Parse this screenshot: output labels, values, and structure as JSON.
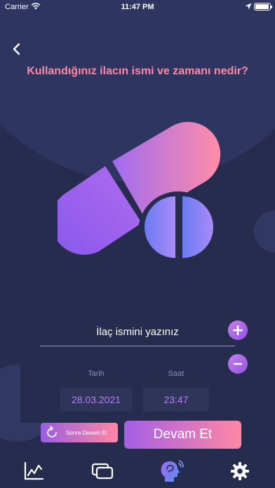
{
  "status_bar": {
    "carrier": "Carrier",
    "time": "11:47 PM"
  },
  "header": {
    "title": "Kullandığınız ilacın ismi ve zamanı nedir?"
  },
  "medication_form": {
    "name_placeholder": "İlaç ismini yazınız",
    "name_value": "",
    "date_label": "Tarih",
    "date_value": "28.03.2021",
    "time_label": "Saat",
    "time_value": "23:47"
  },
  "actions": {
    "later_label": "Sonra Devam Et",
    "continue_label": "Devam Et"
  },
  "tab_bar": {
    "tabs": [
      "stats-icon",
      "cards-icon",
      "profile-icon",
      "settings-icon"
    ],
    "active": "profile-icon"
  },
  "colors": {
    "background": "#262c4d",
    "accent_pink": "#ff87a4",
    "accent_purple": "#9a5fe0",
    "title_pink": "#ff88a6",
    "value_purple": "#b27ff2"
  }
}
